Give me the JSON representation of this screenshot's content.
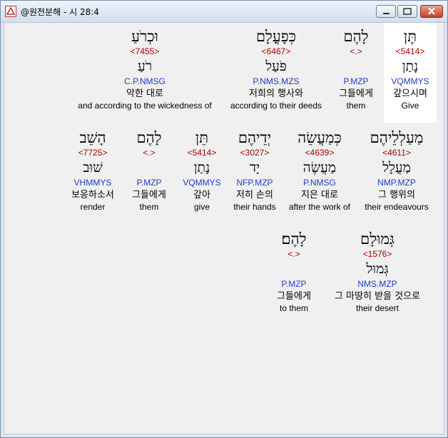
{
  "window": {
    "title": "@원전분해 - 시 28:4"
  },
  "rows": [
    [
      {
        "heb": "וּכְרֹעַ",
        "strong": "<7455>",
        "lemma": "רֹעַ",
        "morph": "C.P.NMSG",
        "kor": "악한 대로",
        "eng": "and according to the wickedness of"
      },
      {
        "heb": "כְּפָעֳלָם",
        "strong": "<6467>",
        "lemma": "פֹּעַל",
        "morph": "P.NMS.MZS",
        "kor": "저희의 행사와",
        "eng": "according to their deeds"
      },
      {
        "heb": "לָהֶם",
        "strong": "<.>",
        "lemma": "",
        "morph": "P.MZP",
        "kor": "그들에게",
        "eng": "them"
      },
      {
        "heb": "תֶּן",
        "strong": "<5414>",
        "lemma": "נָתַן",
        "morph": "VQMMYS",
        "kor": "갚으시며",
        "eng": "Give",
        "selected": true
      }
    ],
    [
      {
        "heb": "הָשֵׁב",
        "strong": "<7725>",
        "lemma": "שׁוּב",
        "morph": "VHMMYS",
        "kor": "보응하소서",
        "eng": "render"
      },
      {
        "heb": "לָהֶם",
        "strong": "<.>",
        "lemma": "",
        "morph": "P.MZP",
        "kor": "그들에게",
        "eng": "them"
      },
      {
        "heb": "תֵּן",
        "strong": "<5414>",
        "lemma": "נָתַן",
        "morph": "VQMMYS",
        "kor": "갚아",
        "eng": "give"
      },
      {
        "heb": "יְדֵיהֶם",
        "strong": "<3027>",
        "lemma": "יָד",
        "morph": "NFP.MZP",
        "kor": "저히 손의",
        "eng": "their hands"
      },
      {
        "heb": "כְּמַעֲשֵׂה",
        "strong": "<4639>",
        "lemma": "מַעֲשֶׂה",
        "morph": "P.NMSG",
        "kor": "지은 대로",
        "eng": "after the work of"
      },
      {
        "heb": "מַעַלְלֵיהֶם",
        "strong": "<4611>",
        "lemma": "מַעֲלָל",
        "morph": "NMP.MZP",
        "kor": "그 행위의",
        "eng": "their endeavours"
      }
    ],
    [
      {
        "heb": "לָהֶם׃",
        "strong": "<.>",
        "lemma": "",
        "morph": "P.MZP",
        "kor": "그들에게",
        "eng": "to them"
      },
      {
        "heb": "גְּמוּלָם",
        "strong": "<1576>",
        "lemma": "גְּמוּל",
        "morph": "NMS.MZP",
        "kor": "그 마땅히 받을 것으로",
        "eng": "their desert"
      }
    ]
  ]
}
